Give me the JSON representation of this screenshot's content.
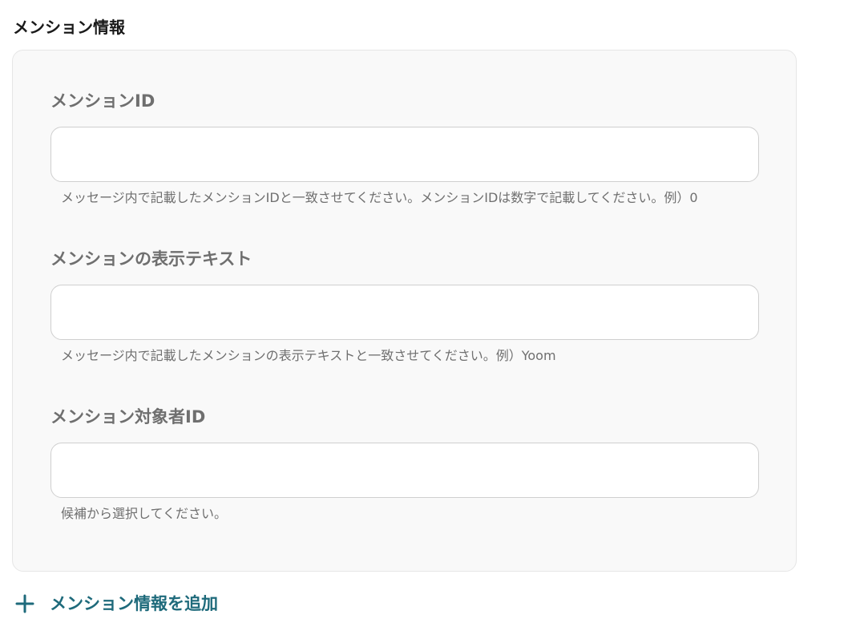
{
  "section": {
    "title": "メンション情報"
  },
  "fields": [
    {
      "label": "メンションID",
      "value": "",
      "placeholder": "",
      "hint": "メッセージ内で記載したメンションIDと一致させてください。メンションIDは数字で記載してください。例）0"
    },
    {
      "label": "メンションの表示テキスト",
      "value": "",
      "placeholder": "",
      "hint": "メッセージ内で記載したメンションの表示テキストと一致させてください。例）Yoom"
    },
    {
      "label": "メンション対象者ID",
      "value": "",
      "placeholder": "",
      "hint": "候補から選択してください。"
    }
  ],
  "add_button": {
    "label": "メンション情報を追加",
    "icon": "plus-icon"
  },
  "colors": {
    "accent": "#1e6a7b",
    "label": "#6f6f6f",
    "card_bg": "#f9f9f9",
    "input_border": "#cfcfcf"
  }
}
